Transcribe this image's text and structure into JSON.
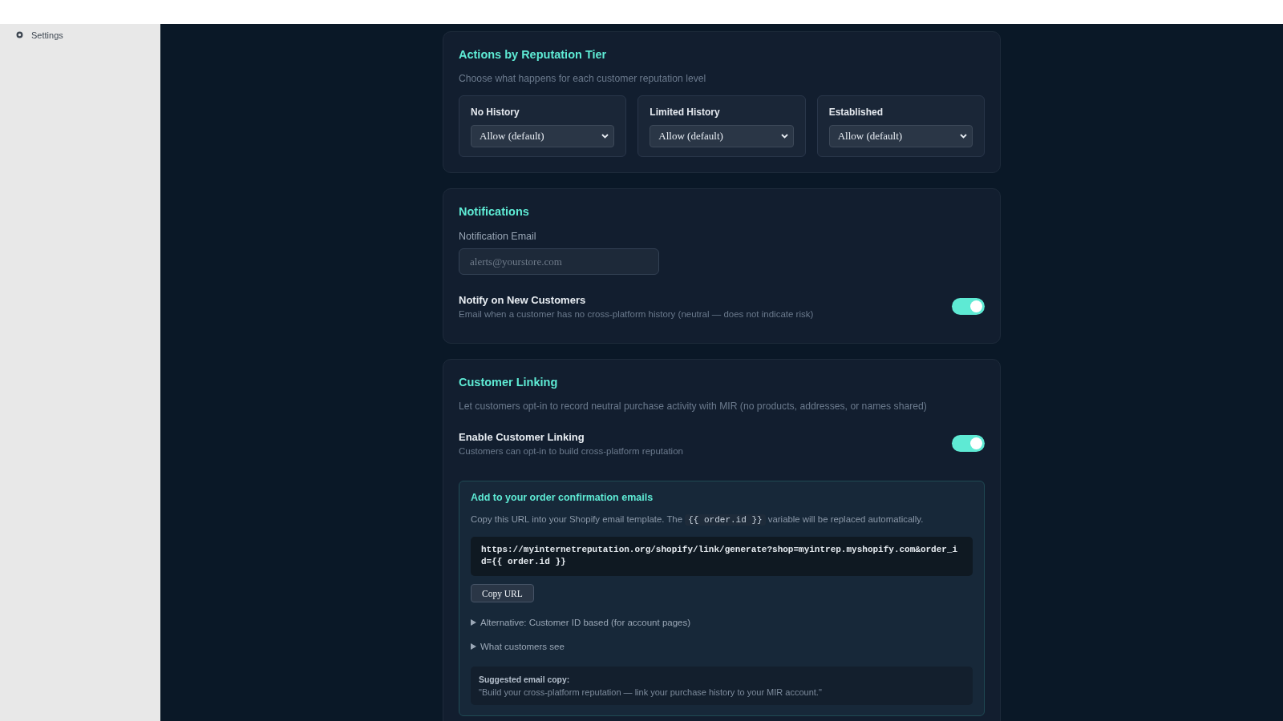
{
  "sidebar": {
    "items": [
      {
        "label": "Settings"
      }
    ]
  },
  "sections": [
    {
      "title": "Actions by Reputation Tier",
      "description": "Choose what happens for each customer reputation level",
      "tiers": [
        {
          "label": "No History",
          "value": "Allow (default)"
        },
        {
          "label": "Limited History",
          "value": "Allow (default)"
        },
        {
          "label": "Established",
          "value": "Allow (default)"
        }
      ]
    },
    {
      "title": "Notifications",
      "fields": [
        {
          "label": "Notification Email",
          "placeholder": "alerts@yourstore.com"
        }
      ],
      "toggles": [
        {
          "title": "Notify on New Customers",
          "description": "Email when a customer has no cross-platform history (neutral — does not indicate risk)",
          "on": true
        }
      ]
    },
    {
      "title": "Customer Linking",
      "description": "Let customers opt-in to record neutral purchase activity with MIR (no products, addresses, or names shared)",
      "toggles": [
        {
          "title": "Enable Customer Linking",
          "description": "Customers can opt-in to build cross-platform reputation",
          "on": true
        }
      ],
      "embed": {
        "title": "Add to your order confirmation emails",
        "instruction": {
          "before": "Copy this URL into your Shopify email template. The",
          "code": "{{ order.id }}",
          "after": "variable will be replaced automatically."
        },
        "url": "https://myinternetreputation.org/shopify/link/generate?shop=myintrep.myshopify.com&order_id={{ order.id }}",
        "button": "Copy URL",
        "disclosures": [
          {
            "label": "Alternative: Customer ID based (for account pages)",
            "expanded": false
          },
          {
            "label": "What customers see",
            "expanded": false
          }
        ],
        "suggestion": {
          "title": "Suggested email copy:",
          "text": "\"Build your cross-platform reputation — link your purchase history to your MIR account.\""
        }
      }
    }
  ]
}
